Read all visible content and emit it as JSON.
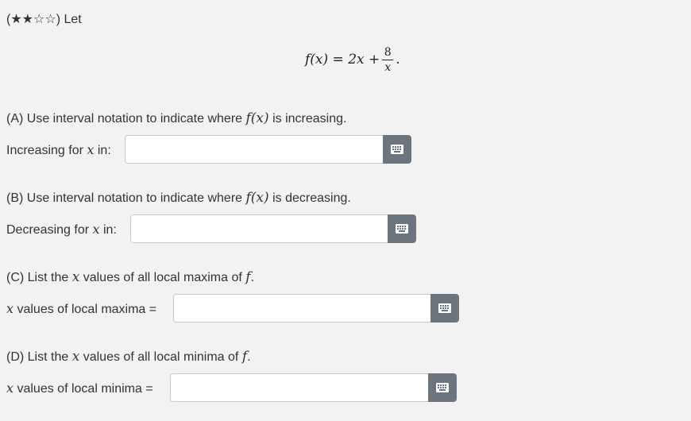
{
  "intro": {
    "prefix": "(",
    "stars_filled": "★★",
    "stars_empty": "☆☆",
    "suffix": ") Let"
  },
  "formula": {
    "lhs": "f(x) = 2x +",
    "num": "8",
    "den": "x",
    "end": "."
  },
  "parts": [
    {
      "question_pre": "(A) Use interval notation to indicate where ",
      "question_math": "f(x)",
      "question_post": " is increasing.",
      "label_pre": "Increasing for ",
      "label_math": "x",
      "label_post": " in:",
      "value": ""
    },
    {
      "question_pre": "(B) Use interval notation to indicate where ",
      "question_math": "f(x)",
      "question_post": " is decreasing.",
      "label_pre": "Decreasing for ",
      "label_math": "x",
      "label_post": " in:",
      "value": ""
    },
    {
      "question_pre": "(C) List the ",
      "question_math": "x",
      "question_post": " values of all local maxima of ",
      "question_math2": "f",
      "question_end": ".",
      "label_pre": "",
      "label_math": "x",
      "label_post": " values of local maxima =",
      "value": ""
    },
    {
      "question_pre": "(D) List the ",
      "question_math": "x",
      "question_post": " values of all local minima of ",
      "question_math2": "f",
      "question_end": ".",
      "label_pre": "",
      "label_math": "x",
      "label_post": " values of local minima =",
      "value": ""
    }
  ],
  "icons": {
    "keyboard": "keyboard-icon"
  },
  "colors": {
    "background": "#f2f2f2",
    "button": "#6c757d",
    "input_border": "#c8c8c8"
  }
}
